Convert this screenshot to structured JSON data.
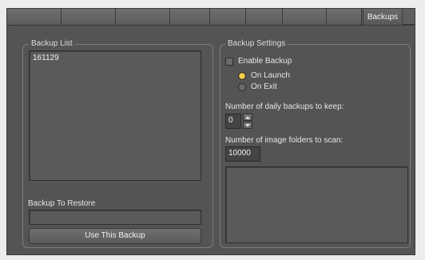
{
  "tabs": [
    {
      "label": ""
    },
    {
      "label": ""
    },
    {
      "label": ""
    },
    {
      "label": ""
    },
    {
      "label": ""
    },
    {
      "label": ""
    },
    {
      "label": ""
    },
    {
      "label": ""
    },
    {
      "label": "Backups"
    }
  ],
  "backup_list": {
    "title": "Backup List",
    "items": [
      "161129"
    ]
  },
  "restore": {
    "label": "Backup To Restore",
    "value": "",
    "button": "Use This Backup"
  },
  "settings": {
    "title": "Backup Settings",
    "enable_backup": {
      "label": "Enable Backup",
      "checked": false
    },
    "radios": [
      {
        "label": "On Launch",
        "selected": true
      },
      {
        "label": "On Exit",
        "selected": false
      }
    ],
    "daily_label": "Number of daily backups to keep:",
    "daily_value": "0",
    "folders_label": "Number of image folders to scan:",
    "folders_value": "10000"
  },
  "colors": {
    "panel": "#545454",
    "radio_on": "#f4d24a"
  }
}
